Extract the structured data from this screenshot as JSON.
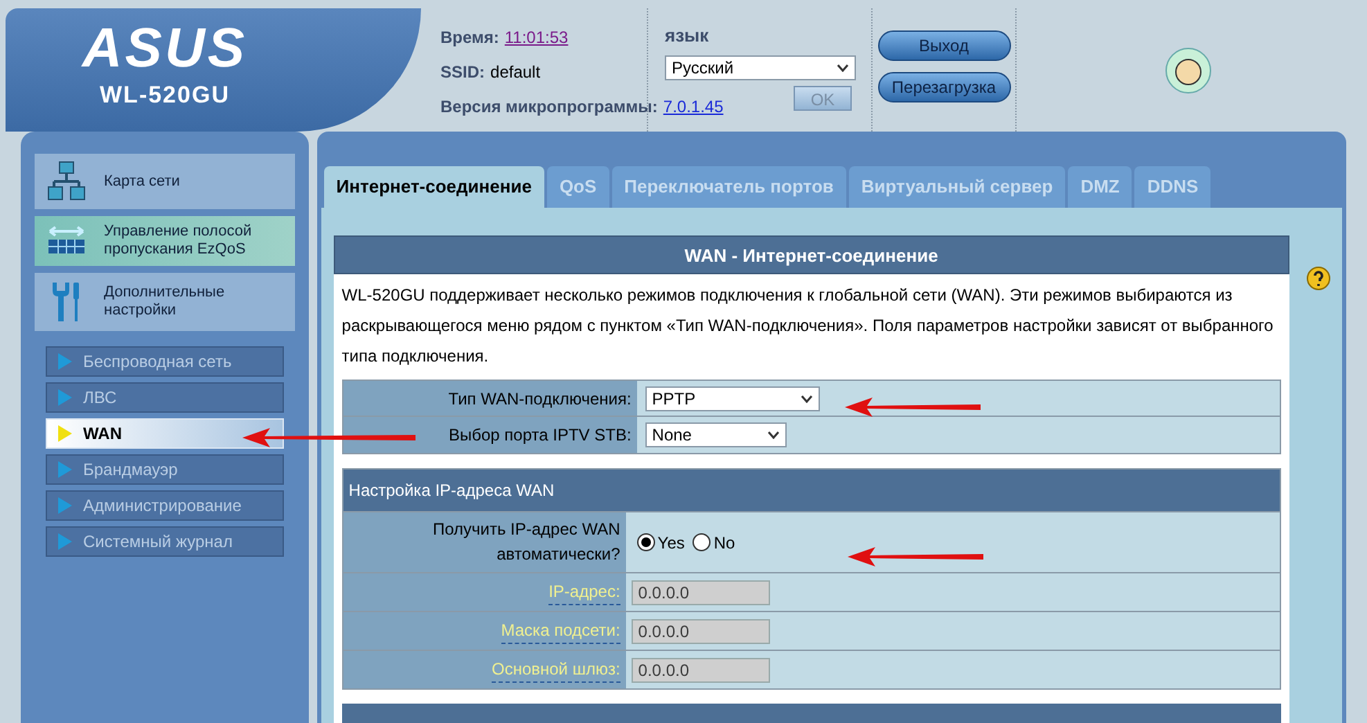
{
  "header": {
    "logo": "ASUS",
    "model": "WL-520GU",
    "time_label": "Время:",
    "time": "11:01:53",
    "ssid_label": "SSID:",
    "ssid": "default",
    "firmware_label": "Версия микропрограммы:",
    "firmware": "7.0.1.45",
    "language_label": "язык",
    "language": "Русский",
    "ok_button": "OK",
    "buttons": [
      "Выход",
      "Перезагрузка"
    ]
  },
  "sidebar": {
    "items": [
      {
        "kind": "map",
        "label": "Карта сети",
        "highlighted": false
      },
      {
        "kind": "qos",
        "label": "Управление полосой пропускания EzQoS",
        "highlighted": true
      },
      {
        "kind": "tools",
        "label": "Дополнительные настройки",
        "highlighted": false
      }
    ],
    "submenu": [
      {
        "label": "Беспроводная сеть",
        "selected": false
      },
      {
        "label": "ЛВС",
        "selected": false
      },
      {
        "label": "WAN",
        "selected": true
      },
      {
        "label": "Брандмауэр",
        "selected": false
      },
      {
        "label": "Администрирование",
        "selected": false
      },
      {
        "label": "Системный журнал",
        "selected": false
      }
    ]
  },
  "tabs": [
    {
      "label": "Интернет-соединение",
      "selected": true
    },
    {
      "label": "QoS",
      "selected": false
    },
    {
      "label": "Переключатель портов",
      "selected": false
    },
    {
      "label": "Виртуальный сервер",
      "selected": false
    },
    {
      "label": "DMZ",
      "selected": false
    },
    {
      "label": "DDNS",
      "selected": false
    }
  ],
  "panel": {
    "title": "WAN - Интернет-соединение",
    "description": "WL-520GU поддерживает несколько режимов подключения к глобальной сети (WAN). Эти режимов выбираются из раскрывающегося меню рядом с пунктом «Тип WAN-подключения». Поля параметров настройки зависят от выбранного типа подключения.",
    "selects": [
      {
        "label": "Тип WAN-подключения:",
        "value": "PPTP"
      },
      {
        "label": "Выбор порта IPTV STB:",
        "value": "None"
      }
    ],
    "section": "Настройка IP-адреса WAN",
    "auto_ip": {
      "label": "Получить IP-адрес WAN автоматически?",
      "options": [
        {
          "label": "Yes",
          "selected": true
        },
        {
          "label": "No",
          "selected": false
        }
      ]
    },
    "fields": [
      {
        "label": "IP-адрес:",
        "value": "0.0.0.0",
        "disabled": true
      },
      {
        "label": "Маска подсети:",
        "value": "0.0.0.0",
        "disabled": true
      },
      {
        "label": "Основной шлюз:",
        "value": "0.0.0.0",
        "disabled": true
      }
    ]
  }
}
